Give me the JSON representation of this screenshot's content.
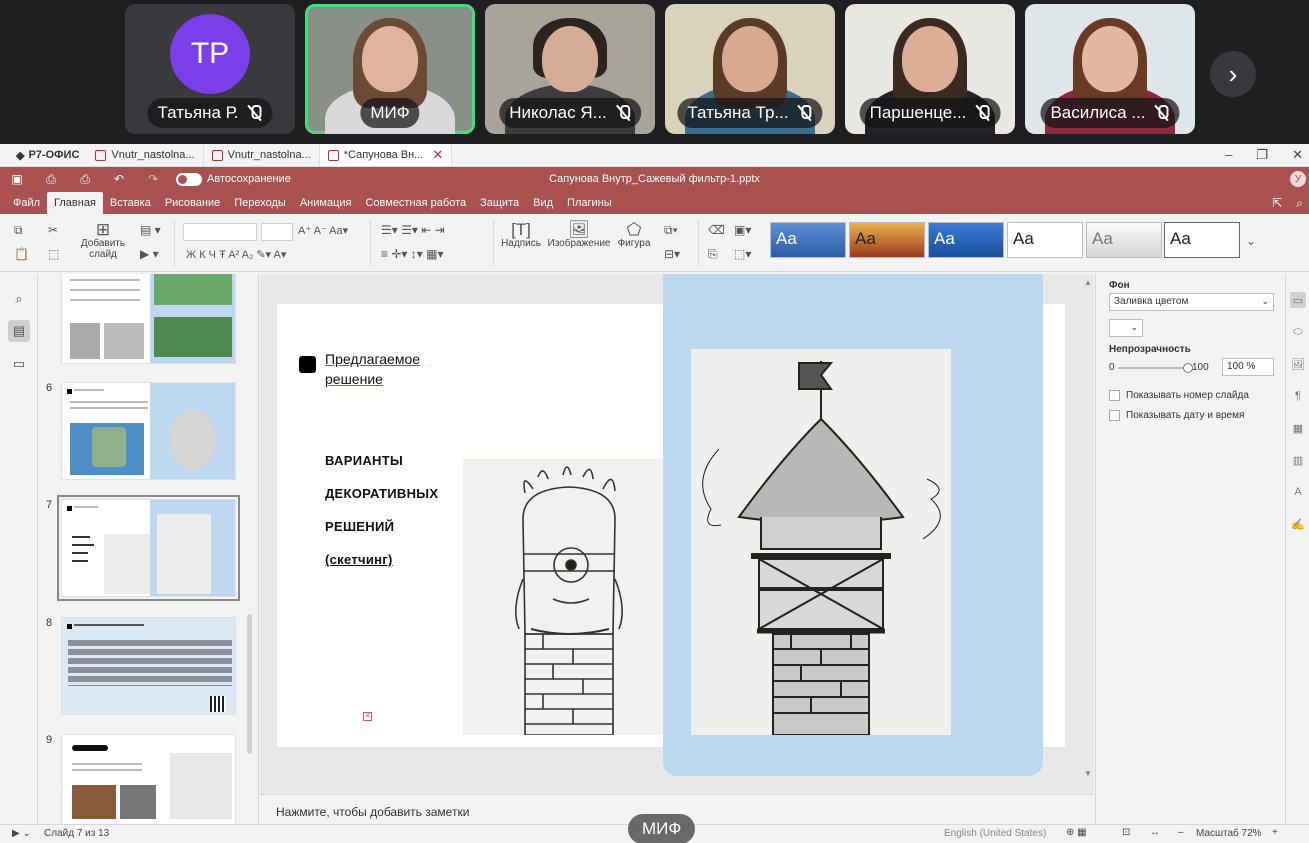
{
  "call": {
    "participants": [
      {
        "name": "Татьяна Р.",
        "initials": "TP",
        "muted": true,
        "video": false
      },
      {
        "name": "МИФ",
        "muted": false,
        "video": true,
        "active": true
      },
      {
        "name": "Николас Я...",
        "muted": true,
        "video": true
      },
      {
        "name": "Татьяна Тр...",
        "muted": true,
        "video": true
      },
      {
        "name": "Паршенце...",
        "muted": true,
        "video": true
      },
      {
        "name": "Василиса ...",
        "muted": true,
        "video": true
      }
    ],
    "next_icon": "chevron-right-icon",
    "speaker_label": "МИФ",
    "avatar_color": "#7b3ee8",
    "active_border_color": "#3ee07c"
  },
  "app": {
    "brand": "Р7-ОФИС",
    "tabs": [
      {
        "label": "Vnutr_nastolna..."
      },
      {
        "label": "Vnutr_nastolna..."
      },
      {
        "label": "*Сапунова Вн..."
      }
    ],
    "autosave_label": "Автосохранение",
    "doc_title": "Сапунова Внутр_Сажевый фильтр-1.pptx",
    "user_initial": "У",
    "accent_color": "#a95050"
  },
  "menu": {
    "items": [
      "Файл",
      "Главная",
      "Вставка",
      "Рисование",
      "Переходы",
      "Анимация",
      "Совместная работа",
      "Защита",
      "Вид",
      "Плагины"
    ],
    "active": "Главная"
  },
  "toolbar": {
    "add_slide": "Добавить слайд",
    "caption": "Надпись",
    "image": "Изображение",
    "shape": "Фигура",
    "theme_sample": "Aa"
  },
  "thumbnails": {
    "numbers": [
      "6",
      "7",
      "8",
      "9"
    ],
    "selected": "7"
  },
  "slide": {
    "title": "Предлагаемое решение",
    "title_lines": [
      "Предлагаемое",
      "решение"
    ],
    "variants": [
      "ВАРИАНТЫ",
      "ДЕКОРАТИВНЫХ",
      "РЕШЕНИЙ",
      "(скетчинг)"
    ]
  },
  "notes_placeholder": "Нажмите, чтобы добавить заметки",
  "right_panel": {
    "background_label": "Фон",
    "fill_select": "Заливка цветом",
    "opacity_label": "Непрозрачность",
    "opacity_min": "0",
    "opacity_max": "100",
    "opacity_value": "100 %",
    "opacity_fraction": 1.0,
    "show_slide_number": "Показывать номер слайда",
    "show_date_time": "Показывать дату и время"
  },
  "status": {
    "slide_counter": "Слайд 7 из 13",
    "language": "English (United States)",
    "zoom": "Масштаб 72%"
  }
}
